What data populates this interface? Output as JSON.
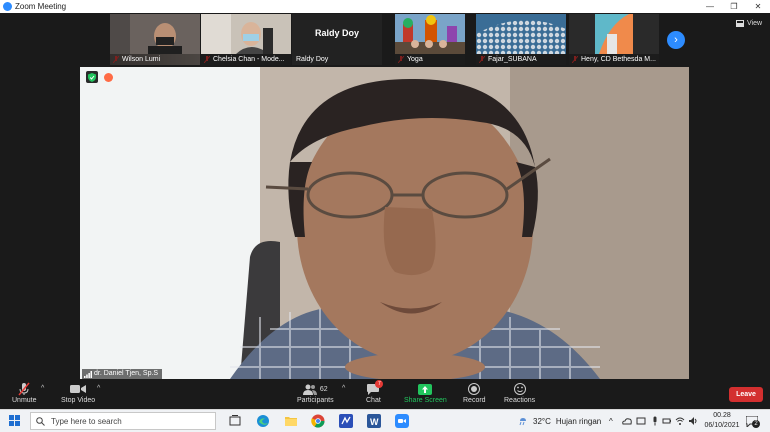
{
  "window": {
    "title": "Zoom Meeting",
    "controls": [
      "—",
      "❐",
      "✕"
    ]
  },
  "participants_strip": [
    {
      "name": "Wilson Lumi",
      "muted": true
    },
    {
      "name": "Chelsia Chan - Mode...",
      "muted": true
    },
    {
      "name": "Raldy Doy",
      "muted": false,
      "display_text": "Raldy Doy"
    },
    {
      "name": "Yoga",
      "muted": true
    },
    {
      "name": "Fajar_SUBANA",
      "muted": true
    },
    {
      "name": "Heny, CD Bethesda M...",
      "muted": true
    }
  ],
  "view_button": "View",
  "speaker": {
    "name": "dr. Daniel Tjen, Sp.S"
  },
  "toolbar": {
    "unmute": "Unmute",
    "stop_video": "Stop Video",
    "participants": "Participants",
    "participants_count": "62",
    "chat": "Chat",
    "chat_badge": "7",
    "share_screen": "Share Screen",
    "record": "Record",
    "reactions": "Reactions",
    "leave": "Leave"
  },
  "taskbar": {
    "search_placeholder": "Type here to search",
    "weather_temp": "32°C",
    "weather_text": "Hujan ringan",
    "time": "00.28",
    "date": "06/10/2021",
    "notification_count": "2"
  },
  "colors": {
    "zoom_blue": "#2d8cff",
    "leave_red": "#d32f2f",
    "share_green": "#22c55e"
  }
}
